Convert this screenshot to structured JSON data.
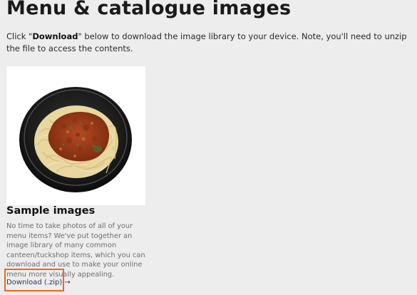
{
  "page": {
    "title": "Menu & catalogue images",
    "intro_prefix": "Click \"",
    "intro_bold": "Download",
    "intro_suffix": "\" below to download the image library to your device. Note, you'll need to unzip the file to access the contents."
  },
  "card": {
    "image_icon": "spaghetti-bolognese-photo",
    "title": "Sample images",
    "description": "No time to take photos of all of your menu items? We've put together an image library of many common canteen/tuckshop items, which you can download and use to make your online menu more visually appealing.",
    "download_label": "Download (.zip) →"
  },
  "colors": {
    "background": "#ededed",
    "highlight": "#f26522",
    "link": "#1f3a5a"
  }
}
